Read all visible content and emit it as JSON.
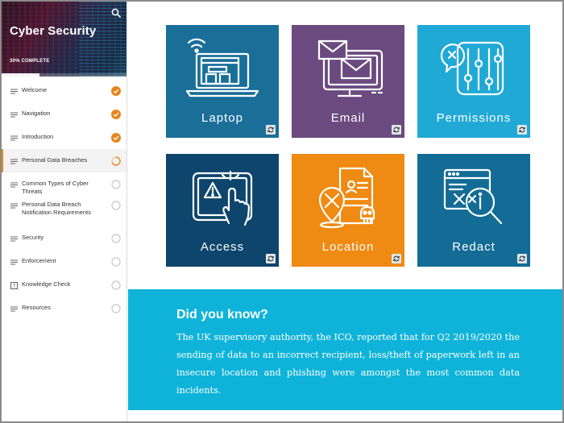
{
  "course": {
    "title": "Cyber Security",
    "progress_text": "30% COMPLETE",
    "progress_fraction": 0.3
  },
  "sidebar": {
    "items": [
      {
        "label": "Welcome",
        "status": "complete"
      },
      {
        "label": "Navigation",
        "status": "complete"
      },
      {
        "label": "Introduction",
        "status": "complete"
      },
      {
        "label": "Personal Data Breaches",
        "status": "in-progress"
      },
      {
        "label": "Common Types of Cyber Threats",
        "status": "not-started"
      },
      {
        "label": "Personal Data Breach Notification Requirements",
        "status": "not-started"
      },
      {
        "label": "Security",
        "status": "not-started"
      },
      {
        "label": "Enforcement",
        "status": "not-started"
      },
      {
        "label": "Knowledge Check",
        "status": "not-started"
      },
      {
        "label": "Resources",
        "status": "not-started"
      }
    ]
  },
  "tiles": [
    {
      "label": "Laptop",
      "color": "#1a6f99",
      "icon": "laptop-wifi-icon"
    },
    {
      "label": "Email",
      "color": "#6a4a7f",
      "icon": "email-monitor-icon"
    },
    {
      "label": "Permissions",
      "color": "#21a9d6",
      "icon": "permissions-sliders-icon"
    },
    {
      "label": "Access",
      "color": "#0e456d",
      "icon": "tablet-warning-icon"
    },
    {
      "label": "Location",
      "color": "#ef8a12",
      "icon": "location-document-icon"
    },
    {
      "label": "Redact",
      "color": "#136c95",
      "icon": "redact-magnifier-icon"
    }
  ],
  "did_you_know": {
    "title": "Did you know?",
    "text": "The UK supervisory authority, the ICO, reported that for Q2 2019/2020 the sending of data to an incorrect recipient, loss/theft of paperwork left in an insecure location and phishing were amongst the most common data incidents."
  },
  "colors": {
    "accent": "#e8841a",
    "callout": "#0fb3d9"
  }
}
